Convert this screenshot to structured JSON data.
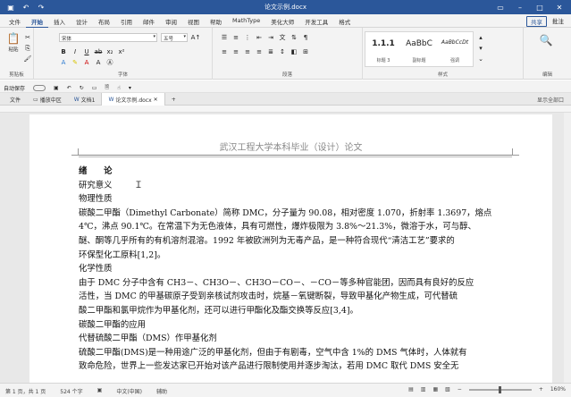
{
  "window": {
    "title": "论文示例.docx"
  },
  "ribbon_tabs": [
    "文件",
    "开始",
    "插入",
    "设计",
    "布局",
    "引用",
    "邮件",
    "审阅",
    "视图",
    "帮助",
    "MathType",
    "美化大师",
    "开发工具",
    "格式"
  ],
  "ribbon_right": {
    "share": "共享",
    "comment": "批注"
  },
  "ribbon": {
    "paste_label": "粘贴",
    "clipboard_group": "剪贴板",
    "font_name": "宋体",
    "font_size": "五号",
    "font_group": "字体",
    "paragraph_group": "段落",
    "styles": [
      {
        "preview": "1.1.1",
        "name": "标题 3"
      },
      {
        "preview": "AaBbC",
        "name": "副标题"
      },
      {
        "preview": "AaBbCcDt",
        "name": "强调"
      }
    ],
    "styles_group": "样式",
    "edit_label": "编辑"
  },
  "qat2": {
    "autosave": "自动保存"
  },
  "doc_tabs": [
    {
      "label": "文件",
      "active": false
    },
    {
      "label": "播放中区",
      "active": false
    },
    {
      "label": "文档1",
      "active": false
    },
    {
      "label": "论文示例.docx",
      "active": true
    }
  ],
  "doc_tabs_right": "显示全部口",
  "document": {
    "header": "武汉工程大学本科毕业（设计）论文",
    "lines": [
      "绪　　论",
      "研究意义",
      "物理性质",
      "碳酸二甲酯（Dimethyl Carbonate）简称 DMC，分子量为 90.08，相对密度 1.070，折射率 1.3697，熔点",
      "4℃，沸点 90.1℃。在常温下为无色液体，具有可燃性，爆炸极限为 3.8%～21.3%，微溶于水，可与醇、",
      "醚、酮等几乎所有的有机溶剂混溶。1992 年被欧洲列为无毒产品，是一种符合现代“清洁工艺”要求的",
      "环保型化工原料[1,2]。",
      "化学性质",
      "由于 DMC 分子中含有 CH3－、CH3O－、CH3O－CO－、－CO－等多种官能团，因而具有良好的反应",
      "活性，当 DMC 的甲基碳原子受到亲核试剂攻击时，烷基－氧键断裂，导致甲基化产物生成，可代替硫",
      "酸二甲酯和氯甲烷作为甲基化剂，还可以进行甲酯化及酯交换等反应[3,4]。",
      "碳酸二甲酯的应用",
      "代替硫酸二甲酯（DMS）作甲基化剂",
      "硫酸二甲酯(DMS)是一种用途广泛的甲基化剂，但由于有剧毒，空气中含 1%的 DMS 气体时，人体就有",
      "致命危险，世界上一些发达家已开始对该产品进行限制使用并逐步淘汰，若用 DMC 取代 DMS 安全无"
    ]
  },
  "status": {
    "page": "第 1 页，共 1 页",
    "words": "524 个字",
    "language": "中文(中国)",
    "focus": "辅助",
    "zoom": "160%"
  }
}
